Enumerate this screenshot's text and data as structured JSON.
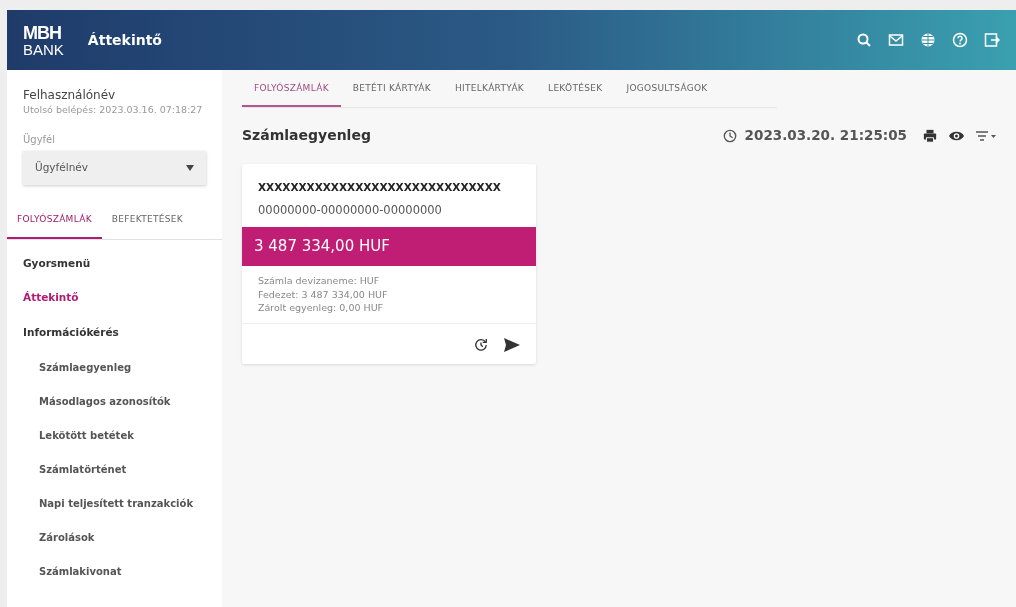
{
  "header": {
    "logo_top": "MBH",
    "logo_bottom": "BANK",
    "title": "Áttekintő"
  },
  "user": {
    "name": "Felhasználónév",
    "last_login": "Utolsó belépés: 2023.03.16. 07:18:27"
  },
  "client": {
    "label": "Ügyfél",
    "value": "Ügyfélnév"
  },
  "sidebar_tabs": [
    {
      "label": "FOLYÓSZÁMLÁK",
      "selected": true
    },
    {
      "label": "BEFEKTETÉSEK",
      "selected": false
    }
  ],
  "sidebar": {
    "items": [
      {
        "label": "Gyorsmenü",
        "selected": false
      },
      {
        "label": "Áttekintő",
        "selected": true
      },
      {
        "label": "Információkérés",
        "selected": false,
        "children": [
          {
            "label": "Számlaegyenleg",
            "selected": false
          },
          {
            "label": "Másodlagos azonosítók",
            "selected": false
          },
          {
            "label": "Lekötött betétek",
            "selected": false
          },
          {
            "label": "Számlatörténet",
            "selected": false
          },
          {
            "label": "Napi teljesített tranzakciók",
            "selected": false
          },
          {
            "label": "Zárolások",
            "selected": false
          },
          {
            "label": "Számlakivonat",
            "selected": false
          }
        ]
      }
    ]
  },
  "tabs": [
    {
      "label": "FOLYÓSZÁMLÁK",
      "selected": true
    },
    {
      "label": "BETÉTI KÁRTYÁK",
      "selected": false
    },
    {
      "label": "HITELKÁRTYÁK",
      "selected": false
    },
    {
      "label": "LEKÖTÉSEK",
      "selected": false
    },
    {
      "label": "JOGOSULTSÁGOK",
      "selected": false
    }
  ],
  "section": {
    "title": "Számlaegyenleg",
    "timestamp": "2023.03.20. 21:25:05"
  },
  "accounts": [
    {
      "name": "XXXXXXXXXXXXXXXXXXXXXXXXXXXXXX",
      "number": "00000000-00000000-00000000",
      "balance": "3 487 334,00 HUF",
      "details": [
        "Számla devizaneme: HUF",
        "Fedezet: 3 487 334,00 HUF",
        "Zárolt egyenleg: 0,00 HUF"
      ]
    }
  ]
}
